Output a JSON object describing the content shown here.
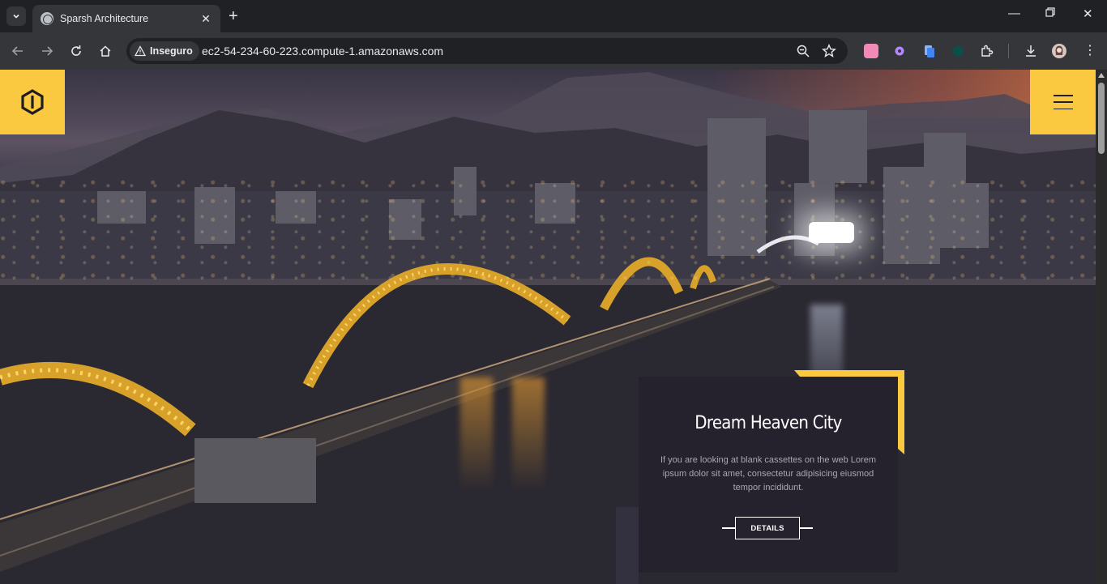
{
  "browser": {
    "tab": {
      "title": "Sparsh Architecture"
    },
    "address": {
      "security_label": "Inseguro",
      "url": "ec2-54-234-60-223.compute-1.amazonaws.com"
    }
  },
  "hero": {
    "card": {
      "title": "Dream Heaven City",
      "description": "If you are looking at blank cassettes on the web Lorem ipsum dolor sit amet, consectetur adipisicing eiusmod tempor incididunt.",
      "button_label": "DETAILS"
    }
  },
  "colors": {
    "accent": "#fbc940",
    "card_bg": "#25222e",
    "chrome_bg": "#202124",
    "toolbar_bg": "#35363a"
  },
  "icons": [
    "tab-search-icon",
    "globe-favicon-icon",
    "close-icon",
    "plus-icon",
    "minimize-icon",
    "restore-icon",
    "window-close-icon",
    "back-icon",
    "forward-icon",
    "reload-icon",
    "home-icon",
    "warning-icon",
    "zoom-icon",
    "star-icon",
    "extensions-icon",
    "download-icon",
    "kebab-menu-icon",
    "hamburger-icon",
    "logo-icon"
  ]
}
